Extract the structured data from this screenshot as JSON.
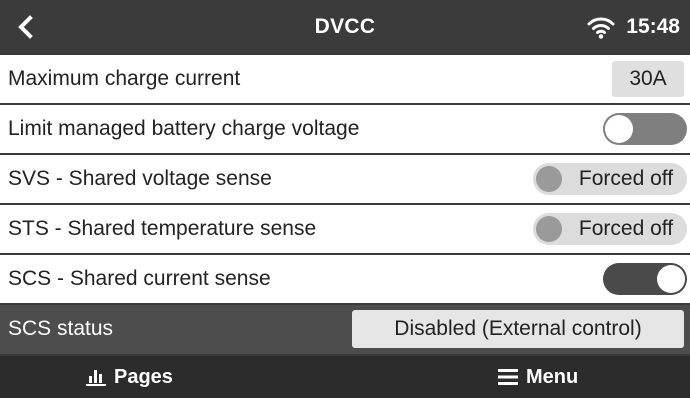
{
  "header": {
    "title": "DVCC",
    "time": "15:48",
    "back_icon": "chevron-left-icon",
    "wifi_icon": "wifi-icon"
  },
  "settings": {
    "max_charge_current": {
      "label": "Maximum charge current",
      "value": "30A"
    },
    "limit_voltage": {
      "label": "Limit managed battery charge voltage",
      "enabled": false
    },
    "svs": {
      "label": "SVS - Shared voltage sense",
      "state": "Forced off"
    },
    "sts": {
      "label": "STS - Shared temperature sense",
      "state": "Forced off"
    },
    "scs": {
      "label": "SCS - Shared current sense",
      "enabled": true
    },
    "scs_status": {
      "label": "SCS status",
      "value": "Disabled (External control)"
    }
  },
  "footer": {
    "pages_label": "Pages",
    "pages_icon": "bar-chart-icon",
    "menu_label": "Menu",
    "menu_icon": "hamburger-menu-icon"
  },
  "colors": {
    "header_bg": "#3b3b3b",
    "footer_bg": "#2c2c2c",
    "selected_row_bg": "#4d4d4d",
    "row_bg": "#ffffff"
  }
}
